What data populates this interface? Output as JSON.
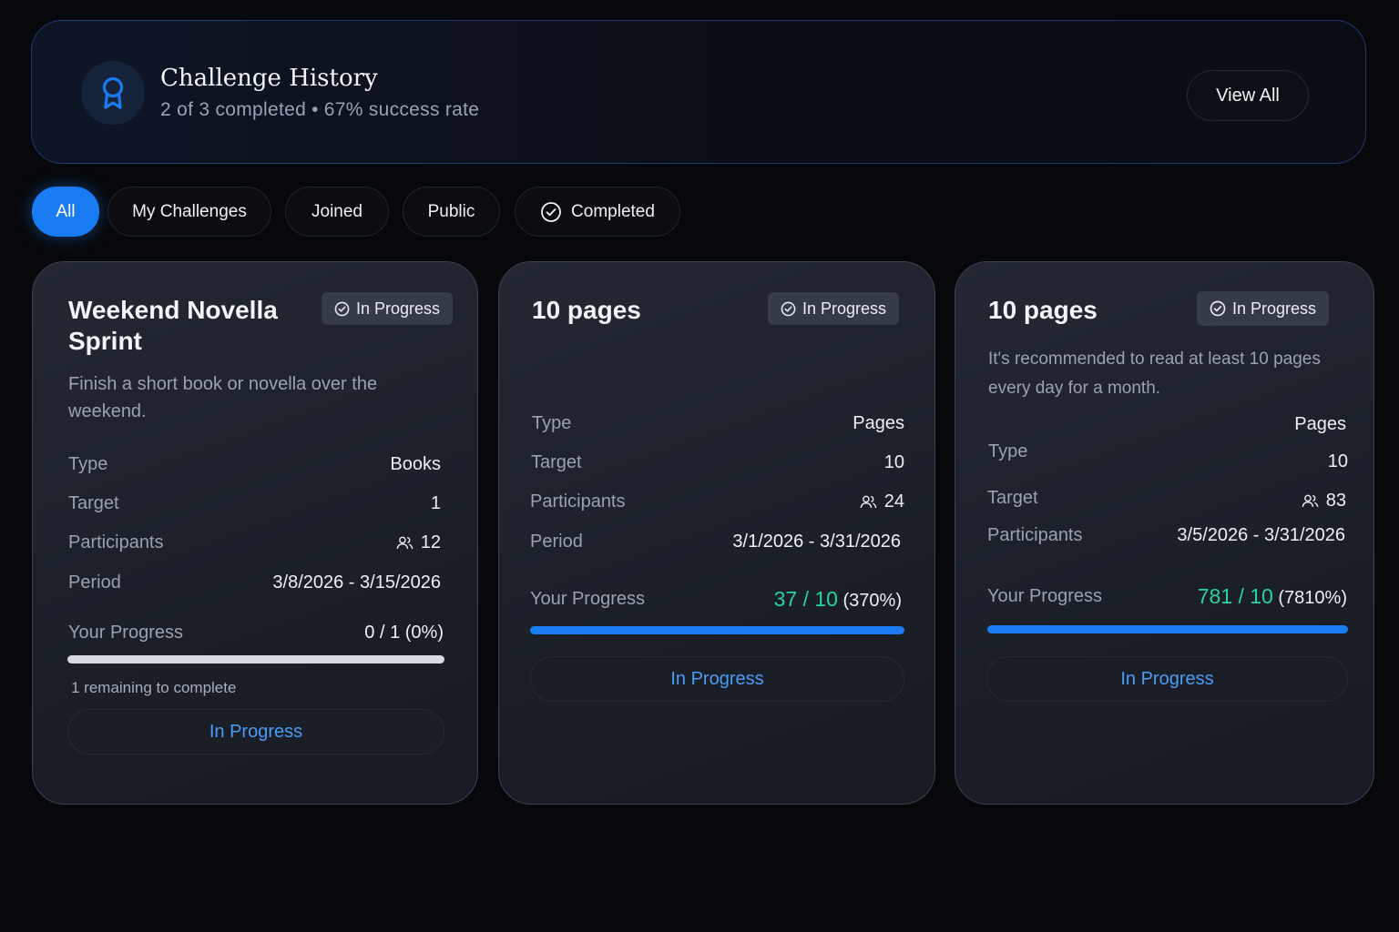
{
  "header": {
    "title": "Challenge History",
    "completed_text": "2 of 3 completed",
    "separator": "•",
    "success_text": "67% success rate",
    "view_all_label": "View All",
    "icon": "award-ribbon-icon"
  },
  "filters": [
    {
      "label": "All",
      "active": true
    },
    {
      "label": "My Challenges",
      "active": false
    },
    {
      "label": "Joined",
      "active": false
    },
    {
      "label": "Public",
      "active": false
    },
    {
      "label": "Completed",
      "active": false,
      "icon": "check-circle-icon"
    }
  ],
  "labels": {
    "type": "Type",
    "target": "Target",
    "participants": "Participants",
    "period": "Period",
    "your_progress": "Your Progress"
  },
  "cards": [
    {
      "title_line1": "Weekend Novella",
      "title_line2": "Sprint",
      "status": "In Progress",
      "desc_line1": "Finish a short book or novella over the",
      "desc_line2": "weekend.",
      "type": "Books",
      "target": "1",
      "participants": "12",
      "period": "3/8/2026 - 3/15/2026",
      "progress_text": "0 / 1 (0%)",
      "progress_fraction": 0,
      "remaining": "1 remaining to complete",
      "action": "In Progress"
    },
    {
      "title": "10 pages",
      "status": "In Progress",
      "type": "Pages",
      "target": "10",
      "participants": "24",
      "period": "3/1/2026 - 3/31/2026",
      "progress_main": "37 / 10",
      "progress_pct": "(370%)",
      "progress_fraction": 1,
      "action": "In Progress"
    },
    {
      "title": "10 pages",
      "status": "In Progress",
      "desc_line1": "It's recommended to read at least 10 pages",
      "desc_line2": "every day for a month.",
      "type": "Pages",
      "target": "10",
      "participants": "83",
      "period": "3/5/2026 - 3/31/2026",
      "progress_main": "781 / 10",
      "progress_pct": "(7810%)",
      "progress_fraction": 1,
      "action": "In Progress"
    }
  ],
  "colors": {
    "accent": "#1a7cf2",
    "progress_green": "#27d3a6",
    "link_blue": "#4a9cf5"
  }
}
